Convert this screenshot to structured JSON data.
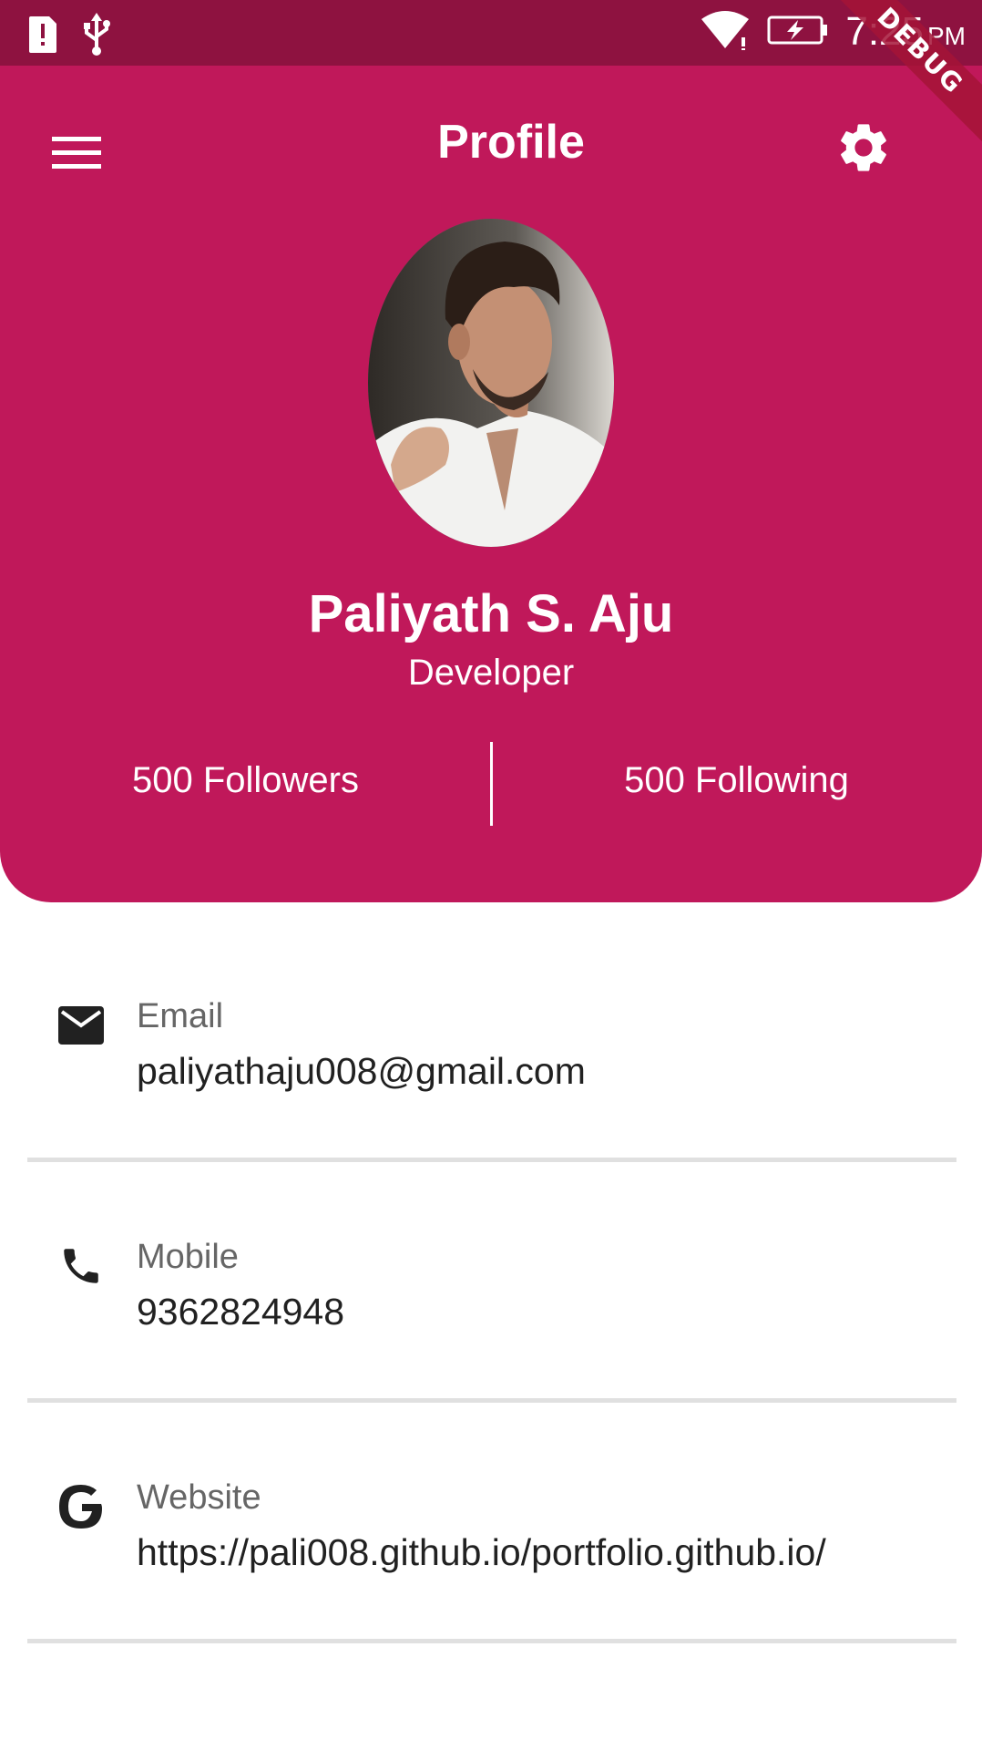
{
  "status_bar": {
    "time": "7:25",
    "ampm": "PM",
    "left_icons": [
      "alert-sim-icon",
      "usb-icon"
    ],
    "right_icons": [
      "wifi-icon",
      "battery-charging-icon"
    ]
  },
  "debug_banner": "DEBUG",
  "appbar": {
    "title": "Profile",
    "menu_icon": "hamburger-menu-icon",
    "settings_icon": "gear-icon"
  },
  "profile": {
    "name": "Paliyath S. Aju",
    "role": "Developer",
    "followers": "500 Followers",
    "following": "500 Following"
  },
  "info": {
    "email": {
      "label": "Email",
      "value": "paliyathaju008@gmail.com",
      "icon": "mail-icon"
    },
    "mobile": {
      "label": "Mobile",
      "value": "9362824948",
      "icon": "phone-icon"
    },
    "website": {
      "label": "Website",
      "value": "https://pali008.github.io/portfolio.github.io/",
      "icon": "google-icon"
    }
  },
  "colors": {
    "primary": "#c0185a",
    "status_bar": "#8e1240",
    "divider": "#e0e0e0"
  }
}
